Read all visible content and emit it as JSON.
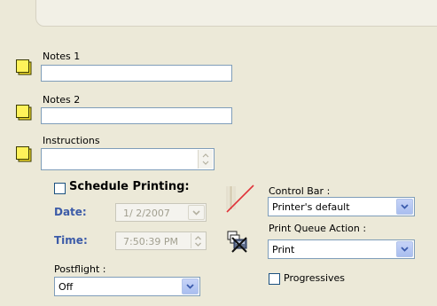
{
  "notes1": {
    "label": "Notes 1",
    "value": ""
  },
  "notes2": {
    "label": "Notes 2",
    "value": ""
  },
  "instructions": {
    "label": "Instructions",
    "value": ""
  },
  "schedule": {
    "label": "Schedule Printing:",
    "checked": false,
    "date_label": "Date:",
    "date_value": "1/  2/2007",
    "time_label": "Time:",
    "time_value": "7:50:39 PM"
  },
  "postflight": {
    "label": "Postflight :",
    "value": "Off"
  },
  "control_bar": {
    "label": "Control Bar :",
    "value": "Printer's default"
  },
  "print_queue": {
    "label": "Print Queue Action :",
    "value": "Print"
  },
  "progressives": {
    "label": "Progressives",
    "checked": false
  },
  "colors": {
    "background": "#ECE9D8",
    "note_yellow": "#FFF25A",
    "field_border": "#7F9DB9",
    "blue_label": "#3C5BA8"
  },
  "icons": {
    "note": "note-icon",
    "control_bar": "control-bar-disabled-icon",
    "print_queue": "print-queue-icon"
  }
}
